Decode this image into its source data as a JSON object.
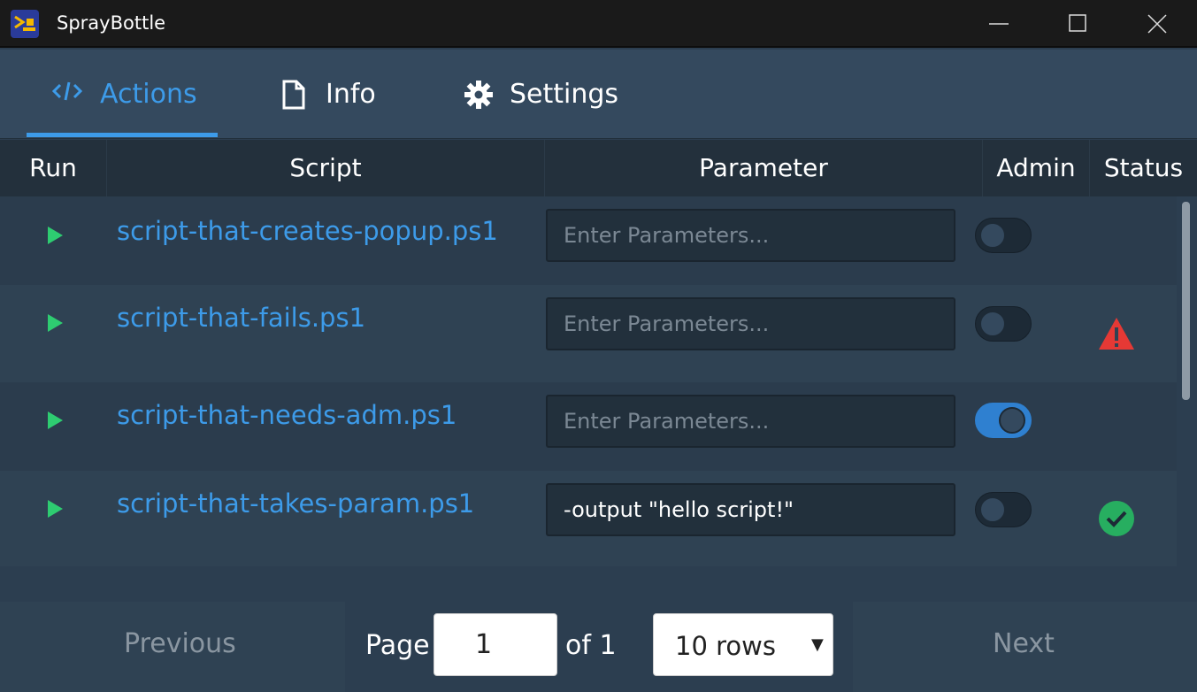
{
  "window": {
    "title": "SprayBottle"
  },
  "tabs": [
    {
      "label": "Actions",
      "icon": "code-icon",
      "active": true
    },
    {
      "label": "Info",
      "icon": "file-icon",
      "active": false
    },
    {
      "label": "Settings",
      "icon": "gear-icon",
      "active": false
    }
  ],
  "table": {
    "columns": [
      "Run",
      "Script",
      "Parameter",
      "Admin",
      "Status"
    ],
    "rows": [
      {
        "script": "script-that-creates-popup.ps1",
        "parameter": "",
        "placeholder": "Enter Parameters...",
        "admin": false,
        "status": "none"
      },
      {
        "script": "script-that-fails.ps1",
        "parameter": "",
        "placeholder": "Enter Parameters...",
        "admin": false,
        "status": "warning-icon"
      },
      {
        "script": "script-that-needs-adm.ps1",
        "parameter": "",
        "placeholder": "Enter Parameters...",
        "admin": true,
        "status": "none"
      },
      {
        "script": "script-that-takes-param.ps1",
        "parameter": "-output \"hello script!\"",
        "placeholder": "Enter Parameters...",
        "admin": false,
        "status": "check-circle-icon"
      }
    ]
  },
  "pagination": {
    "previous_label": "Previous",
    "page_label": "Page",
    "page_value": "1",
    "of_label": "of 1",
    "rows_option": "10 rows",
    "next_label": "Next"
  },
  "colors": {
    "accent": "#3d9be9",
    "run": "#2ecc71",
    "warning": "#e53935",
    "success": "#27ae60",
    "toggle_on": "#2f80d0"
  }
}
